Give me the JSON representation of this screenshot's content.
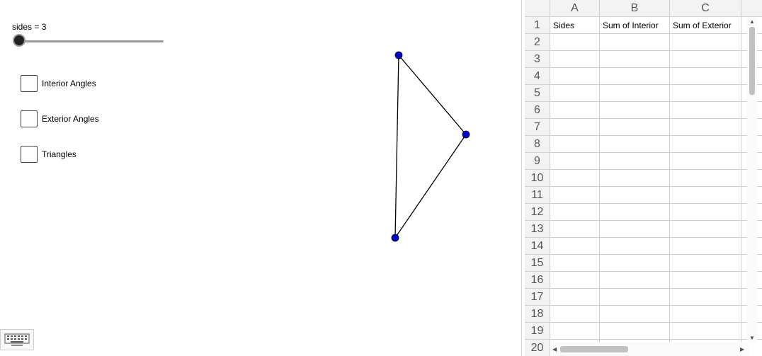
{
  "slider": {
    "label": "sides = 3",
    "value": 3
  },
  "checkboxes": [
    {
      "label": "Interior Angles",
      "checked": false
    },
    {
      "label": "Exterior Angles",
      "checked": false
    },
    {
      "label": "Triangles",
      "checked": false
    }
  ],
  "polygon": {
    "vertex_color": "#0000cc",
    "edge_color": "#000000"
  },
  "keyboard": {
    "icon": "keyboard-icon"
  },
  "spreadsheet": {
    "columns": [
      "A",
      "B",
      "C"
    ],
    "rows": [
      "1",
      "2",
      "3",
      "4",
      "5",
      "6",
      "7",
      "8",
      "9",
      "10",
      "11",
      "12",
      "13",
      "14",
      "15",
      "16",
      "17",
      "18",
      "19",
      "20"
    ],
    "cells": {
      "A1": "Sides",
      "B1": "Sum of Interior",
      "C1": "Sum of Exterior"
    }
  }
}
